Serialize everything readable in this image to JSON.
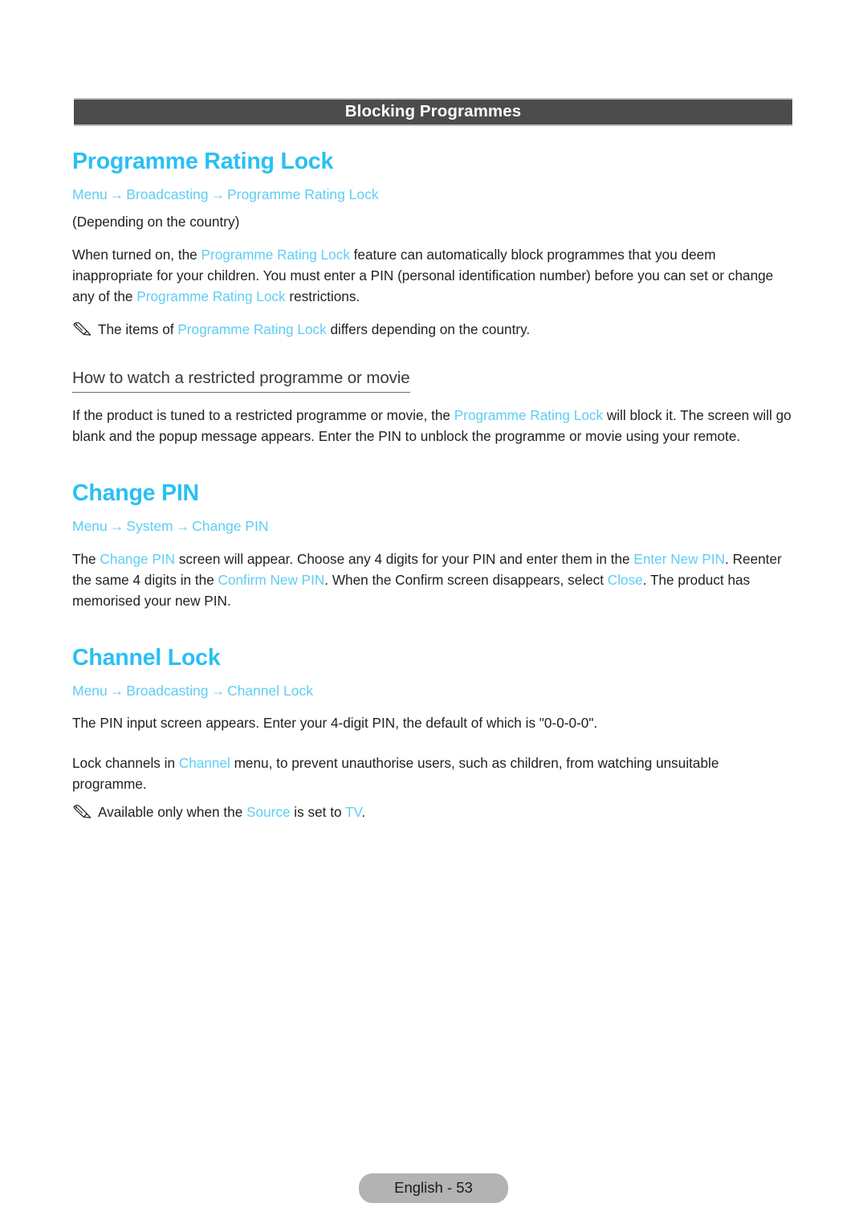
{
  "section_bar": {
    "title": "Blocking Programmes"
  },
  "colors": {
    "heading": "#29c0f2",
    "link": "#5ecdf5",
    "body": "#231f20",
    "bar_bg": "#4c4c4c",
    "footer_bg": "#b3b3b3"
  },
  "sections": {
    "programme_rating_lock": {
      "title": "Programme Rating Lock",
      "breadcrumb": {
        "item1": "Menu",
        "arrow1": "→",
        "item2": "Broadcasting",
        "arrow2": "→",
        "item3": "Programme Rating Lock"
      },
      "depends_note": "(Depending on the country)",
      "paragraph": {
        "part1": "When turned on, the ",
        "link1": "Programme Rating Lock",
        "part2": " feature can automatically block programmes that you deem inappropriate for your children. You must enter a PIN (personal identification number) before you can set or change any of the ",
        "link2": "Programme Rating Lock",
        "part3": " restrictions."
      },
      "note": {
        "icon": "pencil-icon",
        "part1": "The items of ",
        "link1": "Programme Rating Lock",
        "part2": " differs depending on the country."
      },
      "subheading": "How to watch a restricted programme or movie",
      "sub_paragraph": {
        "part1": "If the product is tuned to a restricted programme or movie, the ",
        "link1": "Programme Rating Lock",
        "part2": " will block it. The screen will go blank and the popup message appears. Enter the PIN to unblock the programme or movie using your remote."
      }
    },
    "change_pin": {
      "title": "Change PIN",
      "breadcrumb": {
        "item1": "Menu",
        "arrow1": "→",
        "item2": "System",
        "arrow2": "→",
        "item3": "Change PIN"
      },
      "paragraph": {
        "part1": "The ",
        "link1": "Change PIN",
        "part2": " screen will appear. Choose any 4 digits for your PIN and enter them in the ",
        "link2": "Enter New PIN",
        "part3": ". Reenter the same 4 digits in the ",
        "link3": "Confirm New PIN",
        "part4": ". When the Confirm screen disappears, select ",
        "link4": "Close",
        "part5": ". The product has memorised your new PIN."
      }
    },
    "channel_lock": {
      "title": "Channel Lock",
      "breadcrumb": {
        "item1": "Menu",
        "arrow1": "→",
        "item2": "Broadcasting",
        "arrow2": "→",
        "item3": "Channel Lock"
      },
      "paragraph1": "The PIN input screen appears. Enter your 4-digit PIN, the default of which is \"0-0-0-0\".",
      "paragraph2": {
        "part1": "Lock channels in ",
        "link1": "Channel",
        "part2": " menu, to prevent unauthorise users, such as children, from watching unsuitable programme."
      },
      "note": {
        "icon": "pencil-icon",
        "part1": "Available only when the ",
        "link1": "Source",
        "part2": " is set to ",
        "link2": "TV",
        "part3": "."
      }
    }
  },
  "footer": {
    "page_label": "English - 53"
  }
}
